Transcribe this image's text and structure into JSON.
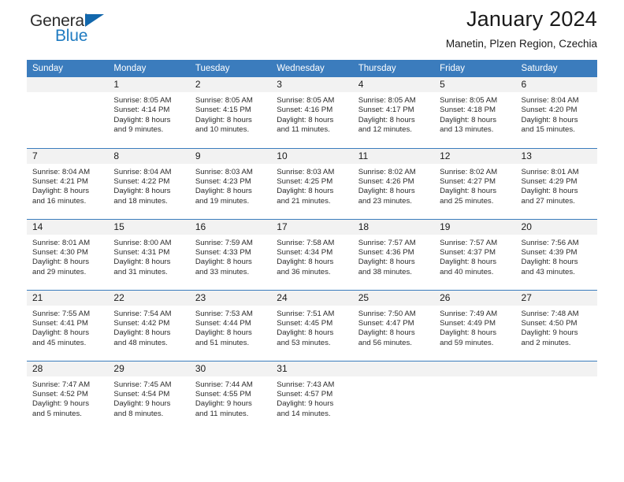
{
  "brand": {
    "name_part1": "General",
    "name_part2": "Blue",
    "logo_icon": "blue-triangle-icon",
    "colors": {
      "dark": "#2d2d2d",
      "blue": "#1f7bc1",
      "triangle": "#1267ac"
    }
  },
  "header": {
    "title": "January 2024",
    "subtitle": "Manetin, Plzen Region, Czechia"
  },
  "calendar": {
    "accent_color": "#3b7cbd",
    "daynum_band_color": "#f2f2f2",
    "weekday_headers": [
      "Sunday",
      "Monday",
      "Tuesday",
      "Wednesday",
      "Thursday",
      "Friday",
      "Saturday"
    ],
    "labels": {
      "sunrise": "Sunrise:",
      "sunset": "Sunset:",
      "daylight": "Daylight:"
    },
    "weeks": [
      [
        {
          "day": "",
          "blank": true
        },
        {
          "day": "1",
          "sunrise": "Sunrise: 8:05 AM",
          "sunset": "Sunset: 4:14 PM",
          "daylight1": "Daylight: 8 hours",
          "daylight2": "and 9 minutes."
        },
        {
          "day": "2",
          "sunrise": "Sunrise: 8:05 AM",
          "sunset": "Sunset: 4:15 PM",
          "daylight1": "Daylight: 8 hours",
          "daylight2": "and 10 minutes."
        },
        {
          "day": "3",
          "sunrise": "Sunrise: 8:05 AM",
          "sunset": "Sunset: 4:16 PM",
          "daylight1": "Daylight: 8 hours",
          "daylight2": "and 11 minutes."
        },
        {
          "day": "4",
          "sunrise": "Sunrise: 8:05 AM",
          "sunset": "Sunset: 4:17 PM",
          "daylight1": "Daylight: 8 hours",
          "daylight2": "and 12 minutes."
        },
        {
          "day": "5",
          "sunrise": "Sunrise: 8:05 AM",
          "sunset": "Sunset: 4:18 PM",
          "daylight1": "Daylight: 8 hours",
          "daylight2": "and 13 minutes."
        },
        {
          "day": "6",
          "sunrise": "Sunrise: 8:04 AM",
          "sunset": "Sunset: 4:20 PM",
          "daylight1": "Daylight: 8 hours",
          "daylight2": "and 15 minutes."
        }
      ],
      [
        {
          "day": "7",
          "sunrise": "Sunrise: 8:04 AM",
          "sunset": "Sunset: 4:21 PM",
          "daylight1": "Daylight: 8 hours",
          "daylight2": "and 16 minutes."
        },
        {
          "day": "8",
          "sunrise": "Sunrise: 8:04 AM",
          "sunset": "Sunset: 4:22 PM",
          "daylight1": "Daylight: 8 hours",
          "daylight2": "and 18 minutes."
        },
        {
          "day": "9",
          "sunrise": "Sunrise: 8:03 AM",
          "sunset": "Sunset: 4:23 PM",
          "daylight1": "Daylight: 8 hours",
          "daylight2": "and 19 minutes."
        },
        {
          "day": "10",
          "sunrise": "Sunrise: 8:03 AM",
          "sunset": "Sunset: 4:25 PM",
          "daylight1": "Daylight: 8 hours",
          "daylight2": "and 21 minutes."
        },
        {
          "day": "11",
          "sunrise": "Sunrise: 8:02 AM",
          "sunset": "Sunset: 4:26 PM",
          "daylight1": "Daylight: 8 hours",
          "daylight2": "and 23 minutes."
        },
        {
          "day": "12",
          "sunrise": "Sunrise: 8:02 AM",
          "sunset": "Sunset: 4:27 PM",
          "daylight1": "Daylight: 8 hours",
          "daylight2": "and 25 minutes."
        },
        {
          "day": "13",
          "sunrise": "Sunrise: 8:01 AM",
          "sunset": "Sunset: 4:29 PM",
          "daylight1": "Daylight: 8 hours",
          "daylight2": "and 27 minutes."
        }
      ],
      [
        {
          "day": "14",
          "sunrise": "Sunrise: 8:01 AM",
          "sunset": "Sunset: 4:30 PM",
          "daylight1": "Daylight: 8 hours",
          "daylight2": "and 29 minutes."
        },
        {
          "day": "15",
          "sunrise": "Sunrise: 8:00 AM",
          "sunset": "Sunset: 4:31 PM",
          "daylight1": "Daylight: 8 hours",
          "daylight2": "and 31 minutes."
        },
        {
          "day": "16",
          "sunrise": "Sunrise: 7:59 AM",
          "sunset": "Sunset: 4:33 PM",
          "daylight1": "Daylight: 8 hours",
          "daylight2": "and 33 minutes."
        },
        {
          "day": "17",
          "sunrise": "Sunrise: 7:58 AM",
          "sunset": "Sunset: 4:34 PM",
          "daylight1": "Daylight: 8 hours",
          "daylight2": "and 36 minutes."
        },
        {
          "day": "18",
          "sunrise": "Sunrise: 7:57 AM",
          "sunset": "Sunset: 4:36 PM",
          "daylight1": "Daylight: 8 hours",
          "daylight2": "and 38 minutes."
        },
        {
          "day": "19",
          "sunrise": "Sunrise: 7:57 AM",
          "sunset": "Sunset: 4:37 PM",
          "daylight1": "Daylight: 8 hours",
          "daylight2": "and 40 minutes."
        },
        {
          "day": "20",
          "sunrise": "Sunrise: 7:56 AM",
          "sunset": "Sunset: 4:39 PM",
          "daylight1": "Daylight: 8 hours",
          "daylight2": "and 43 minutes."
        }
      ],
      [
        {
          "day": "21",
          "sunrise": "Sunrise: 7:55 AM",
          "sunset": "Sunset: 4:41 PM",
          "daylight1": "Daylight: 8 hours",
          "daylight2": "and 45 minutes."
        },
        {
          "day": "22",
          "sunrise": "Sunrise: 7:54 AM",
          "sunset": "Sunset: 4:42 PM",
          "daylight1": "Daylight: 8 hours",
          "daylight2": "and 48 minutes."
        },
        {
          "day": "23",
          "sunrise": "Sunrise: 7:53 AM",
          "sunset": "Sunset: 4:44 PM",
          "daylight1": "Daylight: 8 hours",
          "daylight2": "and 51 minutes."
        },
        {
          "day": "24",
          "sunrise": "Sunrise: 7:51 AM",
          "sunset": "Sunset: 4:45 PM",
          "daylight1": "Daylight: 8 hours",
          "daylight2": "and 53 minutes."
        },
        {
          "day": "25",
          "sunrise": "Sunrise: 7:50 AM",
          "sunset": "Sunset: 4:47 PM",
          "daylight1": "Daylight: 8 hours",
          "daylight2": "and 56 minutes."
        },
        {
          "day": "26",
          "sunrise": "Sunrise: 7:49 AM",
          "sunset": "Sunset: 4:49 PM",
          "daylight1": "Daylight: 8 hours",
          "daylight2": "and 59 minutes."
        },
        {
          "day": "27",
          "sunrise": "Sunrise: 7:48 AM",
          "sunset": "Sunset: 4:50 PM",
          "daylight1": "Daylight: 9 hours",
          "daylight2": "and 2 minutes."
        }
      ],
      [
        {
          "day": "28",
          "sunrise": "Sunrise: 7:47 AM",
          "sunset": "Sunset: 4:52 PM",
          "daylight1": "Daylight: 9 hours",
          "daylight2": "and 5 minutes."
        },
        {
          "day": "29",
          "sunrise": "Sunrise: 7:45 AM",
          "sunset": "Sunset: 4:54 PM",
          "daylight1": "Daylight: 9 hours",
          "daylight2": "and 8 minutes."
        },
        {
          "day": "30",
          "sunrise": "Sunrise: 7:44 AM",
          "sunset": "Sunset: 4:55 PM",
          "daylight1": "Daylight: 9 hours",
          "daylight2": "and 11 minutes."
        },
        {
          "day": "31",
          "sunrise": "Sunrise: 7:43 AM",
          "sunset": "Sunset: 4:57 PM",
          "daylight1": "Daylight: 9 hours",
          "daylight2": "and 14 minutes."
        },
        {
          "day": "",
          "blank": true
        },
        {
          "day": "",
          "blank": true
        },
        {
          "day": "",
          "blank": true
        }
      ]
    ]
  }
}
